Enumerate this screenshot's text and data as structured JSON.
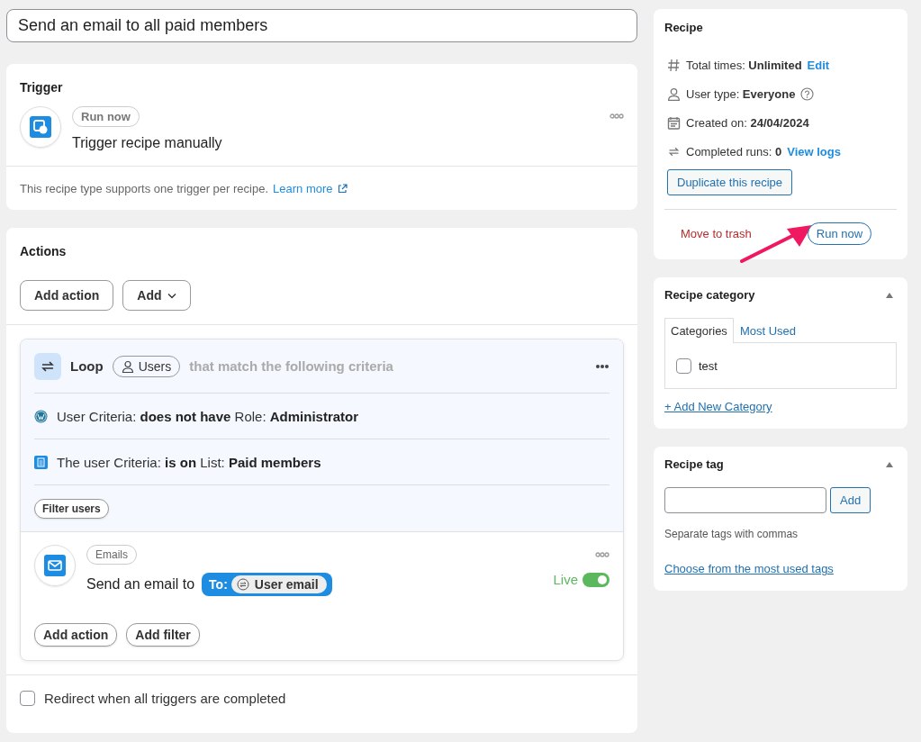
{
  "title_field": {
    "value": "Send an email to all paid members"
  },
  "trigger": {
    "heading": "Trigger",
    "badge": "Run now",
    "text": "Trigger recipe manually",
    "note": "This recipe type supports one trigger per recipe.",
    "link": "Learn more"
  },
  "actions": {
    "heading": "Actions",
    "buttons": [
      {
        "label": "Add action",
        "kind": "plain"
      },
      {
        "label": "Add",
        "kind": "dropdown"
      }
    ],
    "loop": {
      "label": "Loop",
      "badge": "Users",
      "hint": "that match the following criteria",
      "criteria": [
        {
          "kind": "wordpress",
          "text": "User Criteria: **does not have** Role: **Administrator**"
        },
        {
          "kind": "list",
          "text": "The user Criteria: **is on** List: **Paid members**"
        }
      ],
      "filter_button": "Filter users"
    },
    "email": {
      "badge": "Emails",
      "text": "Send an email to",
      "token_label": "To:",
      "token_value": "User email",
      "live_label": "Live",
      "live": true
    },
    "footer_buttons": [
      "Add action",
      "Add filter"
    ],
    "redirect": {
      "label": "Redirect when all triggers are completed",
      "checked": false
    }
  },
  "recipe": {
    "heading": "Recipe",
    "rows": [
      {
        "kind": "hash",
        "label": "Total times:",
        "value": "Unlimited",
        "link": "Edit"
      },
      {
        "kind": "user",
        "label": "User type:",
        "value": "Everyone",
        "help": true
      },
      {
        "kind": "calendar",
        "label": "Created on:",
        "value": "24/04/2024"
      },
      {
        "kind": "loop",
        "label": "Completed runs:",
        "value": "0",
        "link": "View logs"
      }
    ],
    "duplicate": "Duplicate this recipe",
    "trash": "Move to trash",
    "run": "Run now"
  },
  "category": {
    "heading": "Recipe category",
    "tabs": [
      {
        "label": "Categories",
        "selected": true
      },
      {
        "label": "Most Used",
        "selected": false
      }
    ],
    "items": [
      {
        "label": "test",
        "checked": false
      }
    ],
    "add_link": "+ Add New Category"
  },
  "tags": {
    "heading": "Recipe tag",
    "button": "Add",
    "hint": "Separate tags with commas",
    "link": "Choose from the most used tags"
  }
}
